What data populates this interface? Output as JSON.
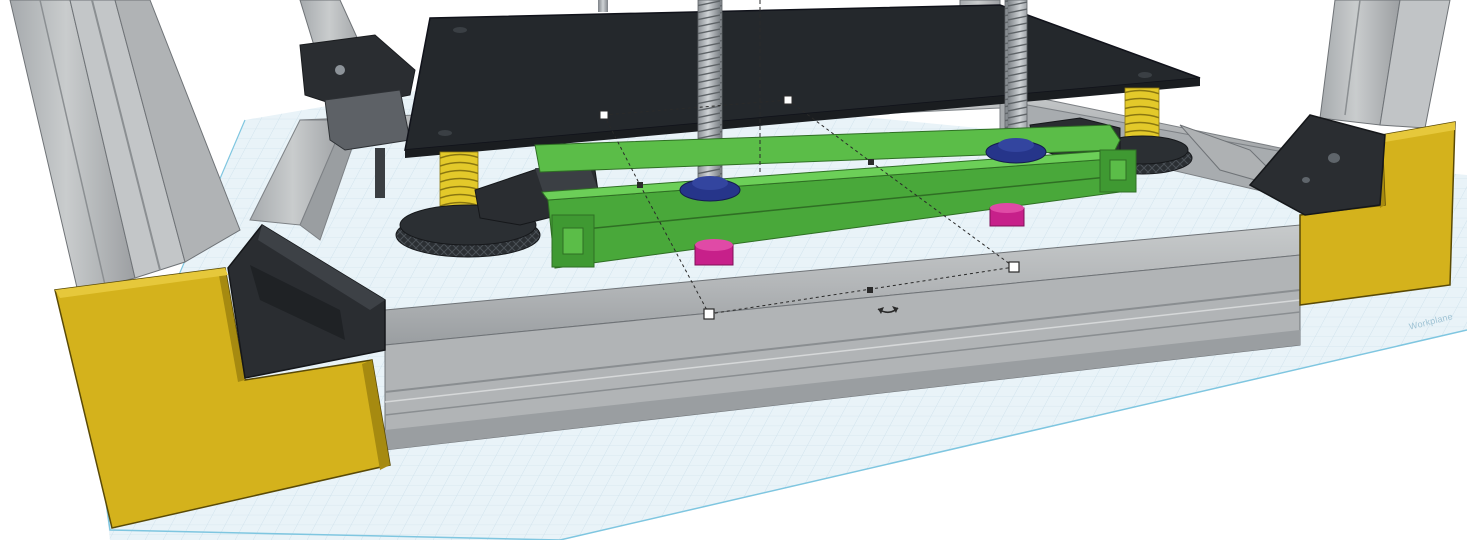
{
  "app": {
    "view": "3d-workplane",
    "workplane_label": "Workplane"
  },
  "colors": {
    "background": "#ffffff",
    "grid_fill": "#e7f1f7",
    "grid_line": "#cfe2ec",
    "grid_edge": "#7fc6e0",
    "aluminum": "#b9bcbe",
    "aluminum_dark": "#8f9396",
    "bracket_yellow": "#d4b21c",
    "bracket_black": "#2a2d31",
    "bed_plate": "#24282c",
    "spring_yellow": "#e3c92a",
    "leadscrew": "#9aa0a5",
    "nut_blue": "#26358a",
    "carriage_green": "#49a83a",
    "nut_magenta": "#c7208a",
    "selection_handle": "#ffffff"
  },
  "scene": {
    "objects": [
      {
        "name": "frame-corner-bracket-left",
        "color": "bracket_yellow"
      },
      {
        "name": "frame-corner-bracket-right",
        "color": "bracket_yellow"
      },
      {
        "name": "heated-bed-plate",
        "color": "bed_plate"
      },
      {
        "name": "bed-spring-left",
        "color": "spring_yellow"
      },
      {
        "name": "bed-spring-right",
        "color": "spring_yellow"
      },
      {
        "name": "z-leadscrew-left",
        "color": "leadscrew"
      },
      {
        "name": "z-leadscrew-right",
        "color": "leadscrew"
      },
      {
        "name": "z-carriage-extrusion",
        "color": "carriage_green"
      },
      {
        "name": "leadscrew-nut-left",
        "color": "nut_magenta"
      },
      {
        "name": "leadscrew-nut-right",
        "color": "nut_magenta"
      }
    ],
    "selection": {
      "active": true,
      "handle_count": 3,
      "resize_handle_count": 5,
      "rotate_arrow": "rotate-arrow-icon"
    }
  }
}
